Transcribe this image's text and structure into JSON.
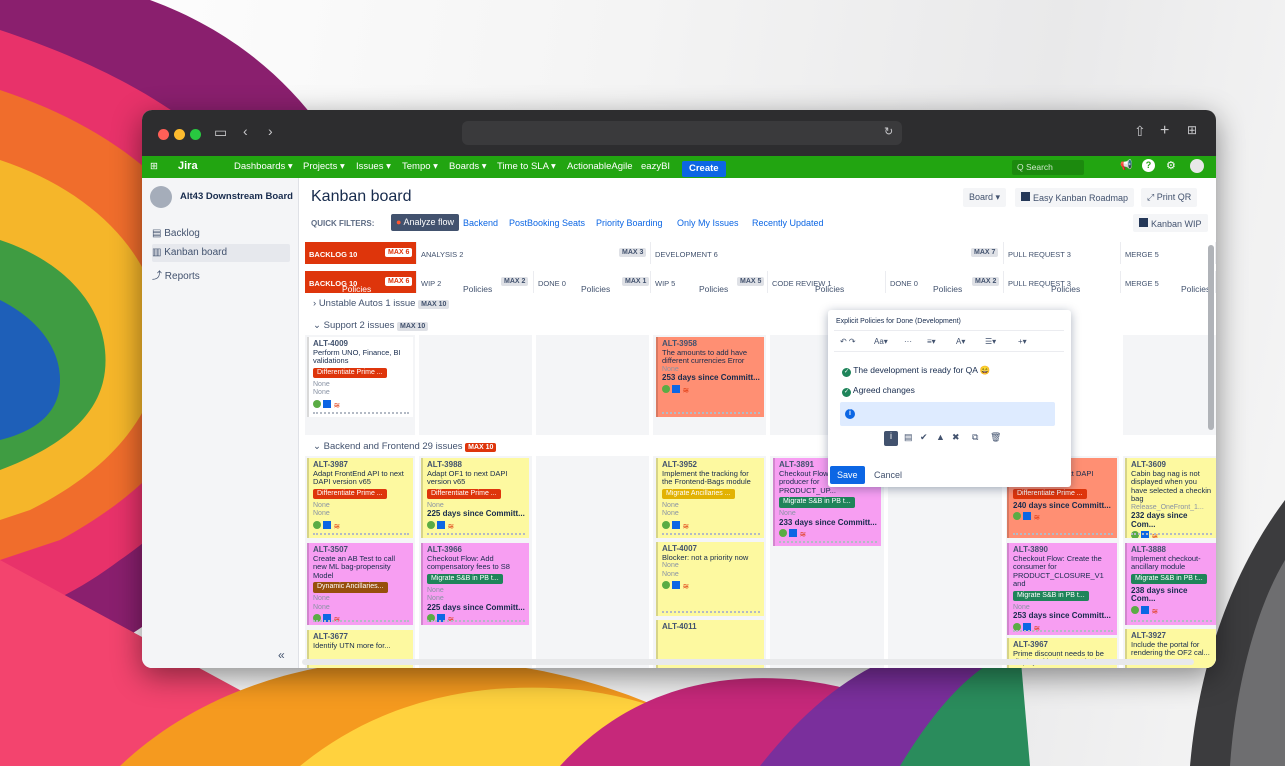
{
  "browser": {
    "icons": [
      "sidebar-icon",
      "back-icon",
      "forward-icon",
      "reload-icon",
      "share-icon",
      "new-tab-icon",
      "tabs-grid-icon"
    ]
  },
  "jira_nav": {
    "logo": "Jira",
    "menu": [
      "Dashboards ▾",
      "Projects ▾",
      "Issues ▾",
      "Tempo ▾",
      "Boards ▾",
      "Time to SLA ▾",
      "ActionableAgile",
      "eazyBI"
    ],
    "create": "Create",
    "search_placeholder": "Q Search"
  },
  "sidebar": {
    "project": "Alt43 Downstream Board",
    "items": [
      "Backlog",
      "Kanban board",
      "Reports"
    ],
    "collapse": "«"
  },
  "board": {
    "title": "Kanban board",
    "buttons": {
      "board": "Board ▾",
      "roadmap": "Easy Kanban Roadmap",
      "print": "Print QR",
      "wip": "Kanban WIP"
    },
    "quick_filters_label": "QUICK FILTERS:",
    "quick_filters": [
      "Analyze flow",
      "Backend",
      "PostBooking Seats",
      "Priority Boarding",
      "Only My Issues",
      "Recently Updated"
    ]
  },
  "columns_top": [
    {
      "label": "BACKLOG 10",
      "max": "MAX 6"
    },
    {
      "label": "ANALYSIS 2",
      "max": "MAX 3"
    },
    {
      "label": "DEVELOPMENT 6",
      "max": "MAX 7"
    },
    {
      "label": "PULL REQUEST 3",
      "max": ""
    },
    {
      "label": "MERGE 5",
      "max": ""
    }
  ],
  "columns_sub": [
    {
      "label": "BACKLOG 10",
      "max": "MAX 6"
    },
    {
      "label": "WIP 2",
      "max": "MAX 2"
    },
    {
      "label": "DONE 0",
      "max": "MAX 1"
    },
    {
      "label": "WIP 5",
      "max": "MAX 5"
    },
    {
      "label": "CODE REVIEW 1",
      "max": ""
    },
    {
      "label": "DONE 0",
      "max": "MAX 2"
    },
    {
      "label": "PULL REQUEST 3",
      "max": ""
    },
    {
      "label": "MERGE 5",
      "max": ""
    }
  ],
  "policies_label": "Policies",
  "swimlanes": [
    {
      "name": "Unstable Autos",
      "count": "1 issue",
      "max": "MAX 10"
    },
    {
      "name": "Support",
      "count": "2 issues",
      "max": "MAX 10"
    },
    {
      "name": "Backend and Frontend",
      "count": "29 issues",
      "max": "MAX 10"
    }
  ],
  "cards": [
    {
      "key": "ALT-4009",
      "summary": "Perform UNO, Finance, BI validations",
      "epic": "Differentiate Prime ...",
      "epic_color": "#de350b",
      "none1": "None",
      "none2": "None",
      "days": "",
      "bg": "#ffffff"
    },
    {
      "key": "ALT-3958",
      "summary": "The amounts to add have different currencies Error",
      "epic": "",
      "epic_color": "",
      "none1": "None",
      "none2": "",
      "days": "253 days since Committ...",
      "bg": "#ff8f73"
    },
    {
      "key": "ALT-3987",
      "summary": "Adapt FrontEnd API to next DAPI version v65",
      "epic": "Differentiate Prime ...",
      "epic_color": "#de350b",
      "none1": "None",
      "none2": "None",
      "days": "",
      "bg": "#fdf9a0"
    },
    {
      "key": "ALT-3988",
      "summary": "Adapt OF1 to next DAPI version v65",
      "epic": "Differentiate Prime ...",
      "epic_color": "#de350b",
      "none1": "None",
      "none2": "",
      "days": "225 days since Committ...",
      "bg": "#fdf9a0"
    },
    {
      "key": "ALT-3952",
      "summary": "Implement the tracking for the Frontend-Bags module",
      "epic": "Migrate Ancillaries ...",
      "epic_color": "#e2b203",
      "none1": "None",
      "none2": "None",
      "days": "",
      "bg": "#fdf9a0"
    },
    {
      "key": "ALT-3891",
      "summary": "Checkout Flow: Create producer for PRODUCT_UP...",
      "epic": "Migrate S&B in PB t...",
      "epic_color": "#1f845a",
      "none1": "None",
      "none2": "",
      "days": "233 days since Committ...",
      "bg": "#f79ef2"
    },
    {
      "key": "ALT-3892",
      "summary": "Adapt OF1 to next DAPI version v65",
      "epic": "Differentiate Prime ...",
      "epic_color": "#de350b",
      "none1": "",
      "none2": "",
      "days": "240 days since Committ...",
      "bg": "#ff8f73"
    },
    {
      "key": "ALT-3609",
      "summary": "Cabin bag nag is not displayed when you have selected a checkin bag",
      "epic": "",
      "epic_color": "",
      "none1": "Release_OneFront_1...",
      "none2": "",
      "days": "232 days since Com...",
      "bg": "#fdf9a0"
    },
    {
      "key": "ALT-3507",
      "summary": "Create an AB Test to call new ML bag-propensity Model",
      "epic": "Dynamic Ancillaries...",
      "epic_color": "#974f0c",
      "none1": "None",
      "none2": "None",
      "days": "",
      "bg": "#f79ef2"
    },
    {
      "key": "ALT-3966",
      "summary": "Checkout Flow: Add compensatory fees to S8",
      "epic": "Migrate S&B in PB t...",
      "epic_color": "#1f845a",
      "none1": "None",
      "none2": "None",
      "days": "225 days since Committ...",
      "bg": "#f79ef2"
    },
    {
      "key": "ALT-4007",
      "summary": "Blocker: not a priority now",
      "epic": "",
      "epic_color": "",
      "none1": "None",
      "none2": "None",
      "days": "",
      "bg": "#fdf9a0"
    },
    {
      "key": "ALT-3890",
      "summary": "Checkout Flow: Create the consumer for PRODUCT_CLOSURE_V1 and",
      "epic": "Migrate S&B in PB t...",
      "epic_color": "#1f845a",
      "none1": "None",
      "none2": "",
      "days": "253 days since Committ...",
      "bg": "#f79ef2"
    },
    {
      "key": "ALT-3888",
      "summary": "Implement checkout-ancillary module",
      "epic": "Migrate S&B in PB t...",
      "epic_color": "#1f845a",
      "none1": "",
      "none2": "",
      "days": "238 days since Com...",
      "bg": "#f79ef2"
    },
    {
      "key": "ALT-3677",
      "summary": "Identify UTN more for...",
      "epic": "",
      "epic_color": "",
      "none1": "",
      "none2": "",
      "days": "",
      "bg": "#fdf9a0"
    },
    {
      "key": "ALT-4011",
      "summary": "",
      "epic": "",
      "epic_color": "",
      "none1": "",
      "none2": "",
      "days": "",
      "bg": "#fdf9a0"
    },
    {
      "key": "ALT-3967",
      "summary": "Prime discount needs to be displayed in the PRP in the...",
      "epic": "",
      "epic_color": "",
      "none1": "",
      "none2": "",
      "days": "",
      "bg": "#fdf9a0"
    },
    {
      "key": "ALT-3927",
      "summary": "Include the portal for rendering the OF2 cal...",
      "epic": "",
      "epic_color": "",
      "none1": "",
      "none2": "",
      "days": "",
      "bg": "#fdf9a0"
    }
  ],
  "popup": {
    "title": "Explicit Policies for Done (Development)",
    "toolbar": [
      "↶ ↷",
      "Aa▾",
      "···",
      "≡▾",
      "A▾",
      "☰▾",
      "+▾"
    ],
    "items": [
      "The development is ready for QA 😄",
      "Agreed changes"
    ],
    "save": "Save",
    "cancel": "Cancel"
  },
  "colors": {
    "jira_green": "#22a511",
    "backlog_red": "#de350b",
    "accent_blue": "#0c66e4"
  }
}
